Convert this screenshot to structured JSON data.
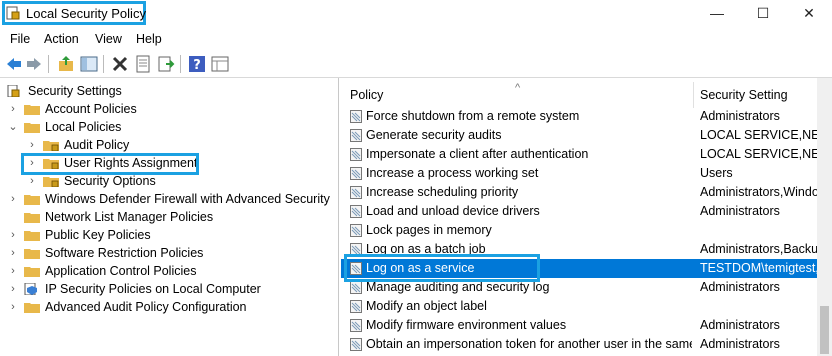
{
  "window": {
    "title": "Local Security Policy",
    "minimize": "—",
    "maximize": "☐",
    "close": "✕"
  },
  "menu": [
    "File",
    "Action",
    "View",
    "Help"
  ],
  "toolbar_icons": [
    "back-arrow-icon",
    "forward-arrow-icon",
    "up-folder-icon",
    "show-hide-tree-icon",
    "delete-icon",
    "properties-icon",
    "export-list-icon",
    "help-icon",
    "details-view-icon"
  ],
  "tree": [
    {
      "label": "Security Settings",
      "chev": ""
    },
    {
      "label": "Account Policies",
      "chev": "›"
    },
    {
      "label": "Local Policies",
      "chev": "⌄"
    },
    {
      "label": "Audit Policy",
      "chev": "›"
    },
    {
      "label": "User Rights Assignment",
      "chev": "›"
    },
    {
      "label": "Security Options",
      "chev": "›"
    },
    {
      "label": "Windows Defender Firewall with Advanced Security",
      "chev": "›"
    },
    {
      "label": "Network List Manager Policies",
      "chev": ""
    },
    {
      "label": "Public Key Policies",
      "chev": "›"
    },
    {
      "label": "Software Restriction Policies",
      "chev": "›"
    },
    {
      "label": "Application Control Policies",
      "chev": "›"
    },
    {
      "label": "IP Security Policies on Local Computer",
      "chev": "›"
    },
    {
      "label": "Advanced Audit Policy Configuration",
      "chev": "›"
    }
  ],
  "list": {
    "col_policy": "Policy",
    "col_setting": "Security Setting",
    "sort_indicator": "^",
    "rows": [
      {
        "policy": "Force shutdown from a remote system",
        "setting": "Administrators"
      },
      {
        "policy": "Generate security audits",
        "setting": "LOCAL SERVICE,NETW"
      },
      {
        "policy": "Impersonate a client after authentication",
        "setting": "LOCAL SERVICE,NETW"
      },
      {
        "policy": "Increase a process working set",
        "setting": "Users"
      },
      {
        "policy": "Increase scheduling priority",
        "setting": "Administrators,Windo"
      },
      {
        "policy": "Load and unload device drivers",
        "setting": "Administrators"
      },
      {
        "policy": "Lock pages in memory",
        "setting": ""
      },
      {
        "policy": "Log on as a batch job",
        "setting": "Administrators,Backu"
      },
      {
        "policy": "Log on as a service",
        "setting": "TESTDOM\\temigtest,"
      },
      {
        "policy": "Manage auditing and security log",
        "setting": "Administrators"
      },
      {
        "policy": "Modify an object label",
        "setting": ""
      },
      {
        "policy": "Modify firmware environment values",
        "setting": "Administrators"
      },
      {
        "policy": "Obtain an impersonation token for another user in the same...",
        "setting": "Administrators"
      }
    ]
  },
  "colors": {
    "accent_box": "#1ba1e2",
    "selection": "#0078d7",
    "folder": "#e8b84a"
  }
}
